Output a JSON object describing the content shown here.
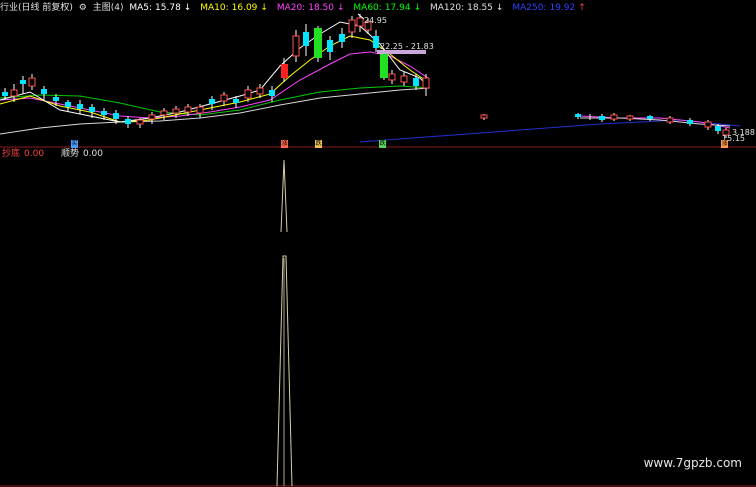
{
  "header": {
    "title": "行业(日线 前复权)",
    "gear_icon": "gear-icon",
    "main_label": "主图(4)",
    "ma5": {
      "label": "MA5:",
      "value": "15.78",
      "arrow": "↓",
      "color": "#ffffff"
    },
    "ma10": {
      "label": "MA10:",
      "value": "16.09",
      "arrow": "↓",
      "color": "#ffff00"
    },
    "ma20": {
      "label": "MA20:",
      "value": "18.50",
      "arrow": "↓",
      "color": "#ff44ff"
    },
    "ma60": {
      "label": "MA60:",
      "value": "17.94",
      "arrow": "↓",
      "color": "#00ff00"
    },
    "ma120": {
      "label": "MA120:",
      "value": "18.55",
      "arrow": "↓",
      "color": "#e0e0e0"
    },
    "ma250": {
      "label": "MA250:",
      "value": "19.92",
      "arrow": "↑",
      "color": "#3040ff"
    }
  },
  "price_labels": {
    "high": "24.95",
    "range": "22.25 - 21.83",
    "right_high": "3.188",
    "right_low": "15.15"
  },
  "badges": [
    {
      "text": "买",
      "color": "#4d9bff"
    },
    {
      "text": "涨",
      "color": "#ff6a4d"
    },
    {
      "text": "跌",
      "color": "#e8c24a"
    },
    {
      "text": "跌",
      "color": "#57d957"
    },
    {
      "text": "涨",
      "color": "#ff9a4d"
    }
  ],
  "indicator": {
    "name": "抄底",
    "name_value": "0.00",
    "name_color": "#ff4040",
    "trend": "顺势",
    "trend_value": "0.00",
    "trend_color": "#e0e0e0"
  },
  "watermark": "www.7gpzb.com"
}
